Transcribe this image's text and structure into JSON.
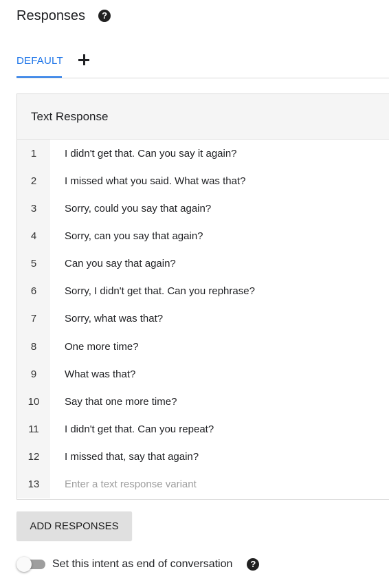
{
  "header": {
    "title": "Responses",
    "help_icon": "?"
  },
  "tabs": [
    {
      "label": "DEFAULT",
      "active": true
    }
  ],
  "add_tab_icon": "plus-icon",
  "card": {
    "title": "Text Response",
    "rows": [
      {
        "num": "1",
        "text": "I didn't get that. Can you say it again?"
      },
      {
        "num": "2",
        "text": "I missed what you said. What was that?"
      },
      {
        "num": "3",
        "text": "Sorry, could you say that again?"
      },
      {
        "num": "4",
        "text": "Sorry, can you say that again?"
      },
      {
        "num": "5",
        "text": "Can you say that again?"
      },
      {
        "num": "6",
        "text": "Sorry, I didn't get that. Can you rephrase?"
      },
      {
        "num": "7",
        "text": "Sorry, what was that?"
      },
      {
        "num": "8",
        "text": "One more time?"
      },
      {
        "num": "9",
        "text": "What was that?"
      },
      {
        "num": "10",
        "text": "Say that one more time?"
      },
      {
        "num": "11",
        "text": "I didn't get that. Can you repeat?"
      },
      {
        "num": "12",
        "text": "I missed that, say that again?"
      }
    ],
    "new_row": {
      "num": "13",
      "value": "",
      "placeholder": "Enter a text response variant"
    }
  },
  "add_button_label": "ADD RESPONSES",
  "end_conversation": {
    "label": "Set this intent as end of conversation",
    "enabled": false,
    "help_icon": "?"
  },
  "colors": {
    "accent": "#1a73e8",
    "header_bg": "#f5f5f5",
    "button_bg": "#e0e0e0"
  }
}
